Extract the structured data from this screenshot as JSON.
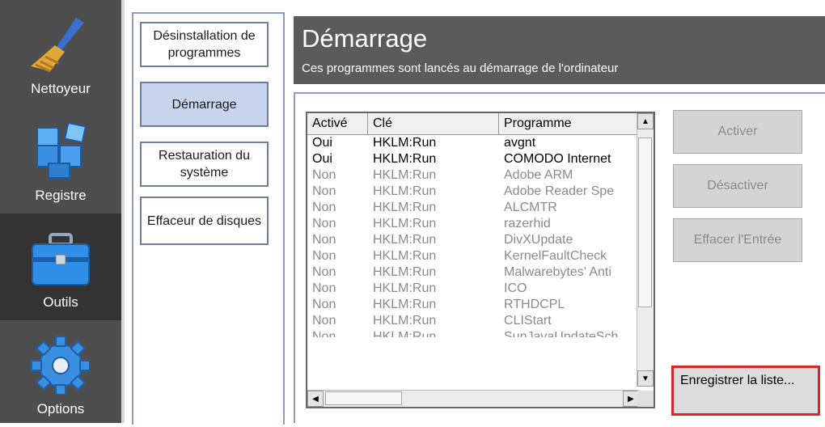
{
  "sidebar": {
    "items": [
      {
        "label": "Nettoyeur",
        "icon": "broom-icon"
      },
      {
        "label": "Registre",
        "icon": "registry-cubes-icon"
      },
      {
        "label": "Outils",
        "icon": "toolbox-icon"
      },
      {
        "label": "Options",
        "icon": "gear-icon"
      }
    ]
  },
  "subnav": {
    "items": [
      {
        "label": "Désinstallation de programmes"
      },
      {
        "label": "Démarrage"
      },
      {
        "label": "Restauration du système"
      },
      {
        "label": "Effaceur de disques"
      }
    ]
  },
  "header": {
    "title": "Démarrage",
    "subtitle": "Ces programmes sont lancés au démarrage de l'ordinateur"
  },
  "table": {
    "columns": [
      "Activé",
      "Clé",
      "Programme"
    ],
    "rows": [
      {
        "active": "Oui",
        "key": "HKLM:Run",
        "program": "avgnt"
      },
      {
        "active": "Oui",
        "key": "HKLM:Run",
        "program": "COMODO Internet"
      },
      {
        "active": "Non",
        "key": "HKLM:Run",
        "program": "Adobe ARM"
      },
      {
        "active": "Non",
        "key": "HKLM:Run",
        "program": "Adobe Reader Spe"
      },
      {
        "active": "Non",
        "key": "HKLM:Run",
        "program": "ALCMTR"
      },
      {
        "active": "Non",
        "key": "HKLM:Run",
        "program": "razerhid"
      },
      {
        "active": "Non",
        "key": "HKLM:Run",
        "program": "DivXUpdate"
      },
      {
        "active": "Non",
        "key": "HKLM:Run",
        "program": "KernelFaultCheck"
      },
      {
        "active": "Non",
        "key": "HKLM:Run",
        "program": "Malwarebytes' Anti"
      },
      {
        "active": "Non",
        "key": "HKLM:Run",
        "program": "ICO"
      },
      {
        "active": "Non",
        "key": "HKLM:Run",
        "program": "RTHDCPL"
      },
      {
        "active": "Non",
        "key": "HKLM:Run",
        "program": "CLIStart"
      },
      {
        "active": "Non",
        "key": "HKLM:Run",
        "program": "SunJavaUpdateSch"
      }
    ]
  },
  "actions": {
    "activate": "Activer",
    "deactivate": "Désactiver",
    "delete_entry": "Effacer l'Entrée",
    "save_list": "Enregistrer la liste..."
  },
  "colors": {
    "sidebar_bg": "#4e4e4e",
    "header_bg": "#5b5b5b",
    "selected_tab": "#c8d4ec",
    "highlight_border": "#d9262c"
  }
}
